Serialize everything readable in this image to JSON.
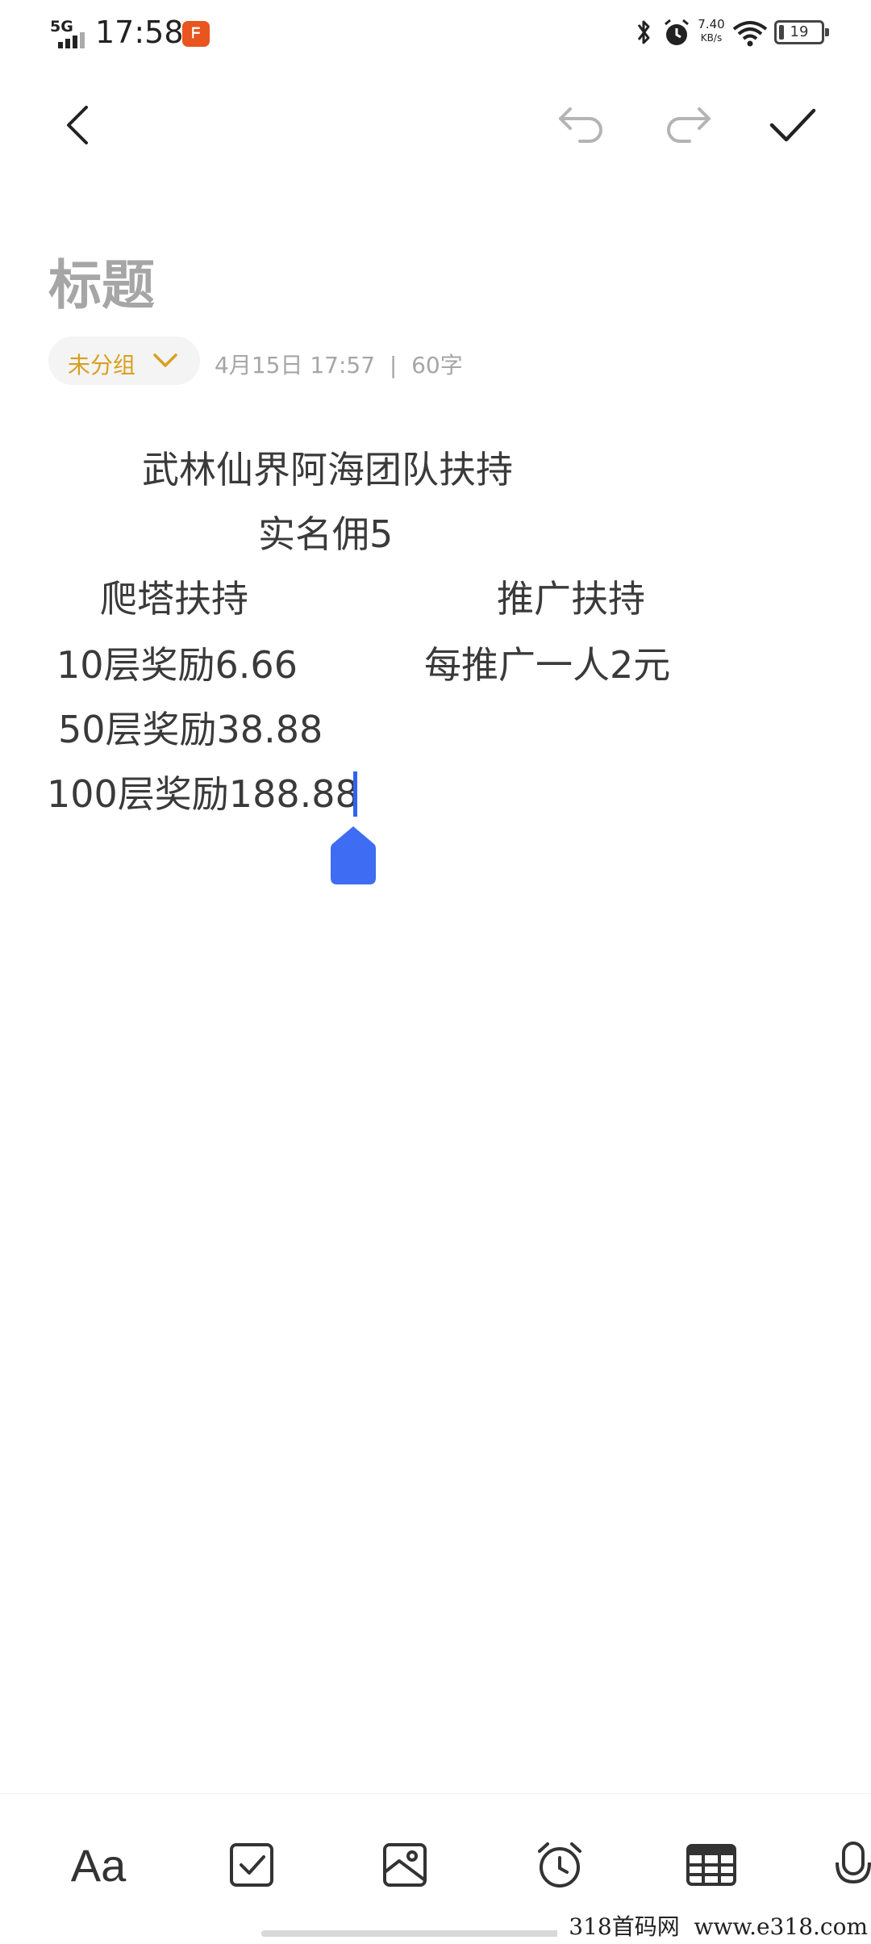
{
  "status_bar": {
    "network": "5G",
    "time": "17:58",
    "app_icon": "app-notification-icon",
    "net_speed_value": "7.40",
    "net_speed_unit": "KB/s",
    "battery": "19"
  },
  "toolbar": {
    "back_icon": "back-arrow-icon",
    "undo_icon": "undo-icon",
    "redo_icon": "redo-icon",
    "done_icon": "checkmark-icon"
  },
  "note": {
    "title_placeholder": "标题",
    "group_label": "未分组",
    "meta_datetime": "4月15日 17:57",
    "meta_separator": "|",
    "meta_count": "60字",
    "lines": [
      "武林仙界阿海团队扶持",
      "实名佣5",
      "爬塔扶持",
      "推广扶持",
      "10层奖励6.66",
      "每推广一人2元",
      "50层奖励38.88",
      "100层奖励188.88"
    ]
  },
  "bottom_tools": {
    "font": "Aa",
    "checklist_icon": "checkbox-icon",
    "image_icon": "image-icon",
    "alarm_icon": "alarm-clock-icon",
    "table_icon": "table-icon",
    "mic_icon": "microphone-icon"
  },
  "watermark": "318首码网  www.e318.com",
  "colors": {
    "accent": "#2f63f0",
    "group_label": "#d8a020",
    "placeholder": "#a6a6a6"
  }
}
